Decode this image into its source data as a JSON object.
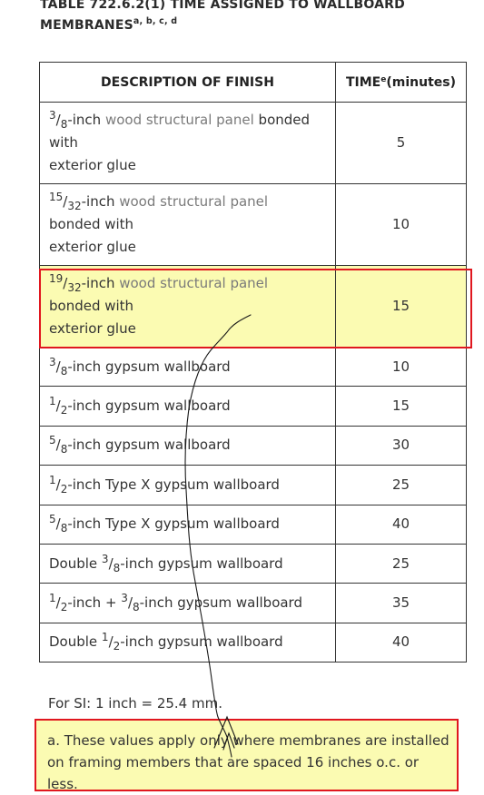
{
  "title": {
    "line1": "TABLE 722.6.2(1) TIME ASSIGNED TO WALLBOARD",
    "line2": "MEMBRANES",
    "sup": "a, b, c, d"
  },
  "headers": {
    "description": "DESCRIPTION OF FINISH",
    "time_main": "TIME",
    "time_sup": "e",
    "time_unit": "(minutes)"
  },
  "rows": [
    {
      "num": "3",
      "den": "8",
      "pre": "",
      "t1": "-inch ",
      "link": "wood structural panel",
      "t2": " bonded",
      "t3": "with",
      "t4": "exterior glue",
      "time": "5"
    },
    {
      "num": "15",
      "den": "32",
      "pre": "",
      "t1": "-inch ",
      "link": "wood structural panel",
      "t2": "",
      "t3": "bonded with",
      "t4": "exterior glue",
      "time": "10"
    },
    {
      "num": "19",
      "den": "32",
      "pre": "",
      "t1": "-inch ",
      "link": "wood structural panel",
      "t2": "",
      "t3": "bonded with",
      "t4": "exterior glue",
      "time": "15"
    },
    {
      "pre": "",
      "num": "3",
      "den": "8",
      "post": "-inch gypsum wallboard",
      "time": "10"
    },
    {
      "pre": "",
      "num": "1",
      "den": "2",
      "post": "-inch gypsum wallboard",
      "time": "15"
    },
    {
      "pre": "",
      "num": "5",
      "den": "8",
      "post": "-inch gypsum wallboard",
      "time": "30"
    },
    {
      "pre": "",
      "num": "1",
      "den": "2",
      "post": "-inch Type X gypsum wallboard",
      "time": "25"
    },
    {
      "pre": "",
      "num": "5",
      "den": "8",
      "post": "-inch Type X gypsum wallboard",
      "time": "40"
    },
    {
      "pre": "Double ",
      "num": "3",
      "den": "8",
      "post": "-inch gypsum wallboard",
      "time": "25"
    },
    {
      "pre": "",
      "num": "1",
      "den": "2",
      "mid": "-inch + ",
      "num2": "3",
      "den2": "8",
      "post": "-inch gypsum wallboard",
      "time": "35"
    },
    {
      "pre": "Double ",
      "num": "1",
      "den": "2",
      "post": "-inch gypsum wallboard",
      "time": "40"
    }
  ],
  "footnote_si": "For SI: 1 inch = 25.4 mm.",
  "note_a": "a. These values apply only where membranes are installed on framing members that are spaced 16 inches o.c. or less.",
  "colors": {
    "highlight": "#fbfbb2",
    "annotation_border": "#e0171f",
    "link_text": "#7a7a7a"
  }
}
